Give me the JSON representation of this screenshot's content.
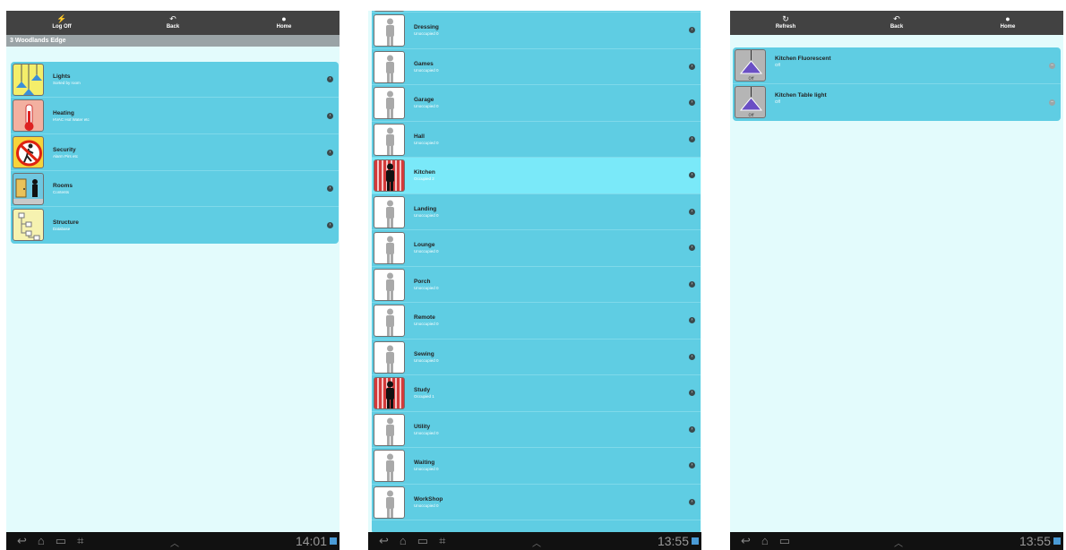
{
  "screen1": {
    "toolbar": [
      {
        "label": "Log Off",
        "icon": "log-off-icon"
      },
      {
        "label": "Back",
        "icon": "back-icon"
      },
      {
        "label": "Home",
        "icon": "home-icon"
      }
    ],
    "breadcrumb": "3 Woodlands Edge",
    "items": [
      {
        "title": "Lights",
        "subtitle": "Sorted by room",
        "icon": "lights-icon"
      },
      {
        "title": "Heating",
        "subtitle": "HVAC Hot Water etc",
        "icon": "thermometer-icon"
      },
      {
        "title": "Security",
        "subtitle": "Alarm Pirs etc",
        "icon": "security-icon"
      },
      {
        "title": "Rooms",
        "subtitle": "Contents",
        "icon": "rooms-icon"
      },
      {
        "title": "Structure",
        "subtitle": "Database",
        "icon": "structure-icon"
      }
    ],
    "time": "14:01"
  },
  "screen2": {
    "items": [
      {
        "title": "Dressing",
        "subtitle": "Unoccupied 0",
        "occupied": false
      },
      {
        "title": "Games",
        "subtitle": "Unoccupied 0",
        "occupied": false
      },
      {
        "title": "Garage",
        "subtitle": "Unoccupied 0",
        "occupied": false
      },
      {
        "title": "Hall",
        "subtitle": "Unoccupied 0",
        "occupied": false
      },
      {
        "title": "Kitchen",
        "subtitle": "Occupied 2",
        "occupied": true
      },
      {
        "title": "Landing",
        "subtitle": "Unoccupied 0",
        "occupied": false
      },
      {
        "title": "Lounge",
        "subtitle": "Unoccupied 0",
        "occupied": false
      },
      {
        "title": "Porch",
        "subtitle": "Unoccupied 0",
        "occupied": false
      },
      {
        "title": "Remote",
        "subtitle": "Unoccupied 0",
        "occupied": false
      },
      {
        "title": "Sewing",
        "subtitle": "Unoccupied 0",
        "occupied": false
      },
      {
        "title": "Study",
        "subtitle": "Occupied 1",
        "occupied": true
      },
      {
        "title": "Utility",
        "subtitle": "Unoccupied 0",
        "occupied": false
      },
      {
        "title": "Waiting",
        "subtitle": "Unoccupied 0",
        "occupied": false
      },
      {
        "title": "WorkShop",
        "subtitle": "Unoccupied 0",
        "occupied": false
      }
    ],
    "time": "13:55"
  },
  "screen3": {
    "toolbar": [
      {
        "label": "Refresh",
        "icon": "refresh-icon"
      },
      {
        "label": "Back",
        "icon": "back-icon"
      },
      {
        "label": "Home",
        "icon": "home-icon"
      }
    ],
    "items": [
      {
        "title": "Kitchen Fluorescent",
        "subtitle": "Off",
        "icon": "lamp-icon"
      },
      {
        "title": "Kitchen Table light",
        "subtitle": "Off",
        "icon": "lamp-icon"
      }
    ],
    "time": "13:55"
  },
  "colors": {
    "list_bg": "#5fcde3",
    "highlight": "#7ae9f9",
    "screen_bg": "#e3fbfc",
    "toolbar": "#424242"
  }
}
